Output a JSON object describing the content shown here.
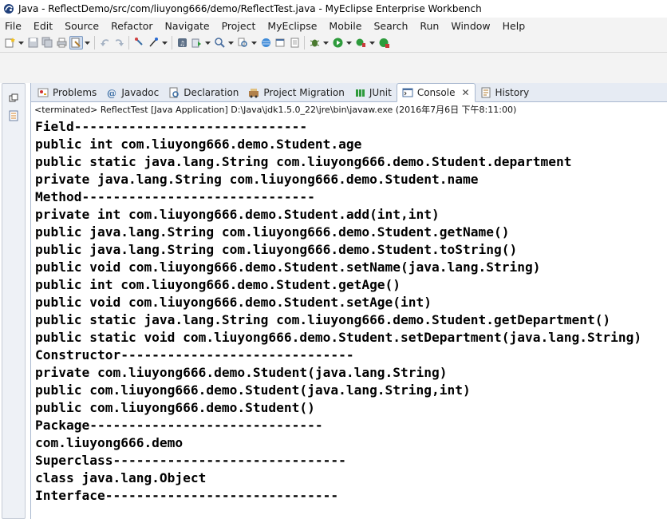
{
  "window": {
    "title": "Java - ReflectDemo/src/com/liuyong666/demo/ReflectTest.java - MyEclipse Enterprise Workbench",
    "icon": "myeclipse-icon"
  },
  "menubar": {
    "items": [
      "File",
      "Edit",
      "Source",
      "Refactor",
      "Navigate",
      "Project",
      "MyEclipse",
      "Mobile",
      "Search",
      "Run",
      "Window",
      "Help"
    ]
  },
  "toolbar": {
    "icons": [
      "new-icon",
      "save-icon",
      "save-all-icon",
      "print-icon",
      "open-type-icon",
      "toggle-mark-icon",
      "back-icon",
      "forward-icon",
      "pin-icon",
      "search-icon",
      "server-icon",
      "deploy-icon",
      "web-browser-icon",
      "open-perspective-icon",
      "debug-icon",
      "run-icon",
      "external-tools-icon"
    ]
  },
  "view": {
    "tabs": [
      {
        "label": "Problems",
        "icon": "problems-icon",
        "active": false
      },
      {
        "label": "Javadoc",
        "icon": "javadoc-icon",
        "active": false
      },
      {
        "label": "Declaration",
        "icon": "declaration-icon",
        "active": false
      },
      {
        "label": "Project Migration",
        "icon": "migration-icon",
        "active": false
      },
      {
        "label": "JUnit",
        "icon": "junit-icon",
        "active": false
      },
      {
        "label": "Console",
        "icon": "console-icon",
        "active": true
      },
      {
        "label": "History",
        "icon": "history-icon",
        "active": false
      }
    ],
    "close_glyph": "✕",
    "status": "<terminated> ReflectTest [Java Application] D:\\Java\\jdk1.5.0_22\\jre\\bin\\javaw.exe (2016年7月6日 下午8:11:00)"
  },
  "console": {
    "lines": [
      "Field------------------------------",
      "public int com.liuyong666.demo.Student.age",
      "public static java.lang.String com.liuyong666.demo.Student.department",
      "private java.lang.String com.liuyong666.demo.Student.name",
      "Method------------------------------",
      "private int com.liuyong666.demo.Student.add(int,int)",
      "public java.lang.String com.liuyong666.demo.Student.getName()",
      "public java.lang.String com.liuyong666.demo.Student.toString()",
      "public void com.liuyong666.demo.Student.setName(java.lang.String)",
      "public int com.liuyong666.demo.Student.getAge()",
      "public void com.liuyong666.demo.Student.setAge(int)",
      "public static java.lang.String com.liuyong666.demo.Student.getDepartment()",
      "public static void com.liuyong666.demo.Student.setDepartment(java.lang.String)",
      "Constructor------------------------------",
      "private com.liuyong666.demo.Student(java.lang.String)",
      "public com.liuyong666.demo.Student(java.lang.String,int)",
      "public com.liuyong666.demo.Student()",
      "Package------------------------------",
      "com.liuyong666.demo",
      "Superclass------------------------------",
      "class java.lang.Object",
      "Interface------------------------------"
    ]
  },
  "trim": {
    "icons": [
      "restore-icon",
      "outline-icon"
    ]
  },
  "colors": {
    "accent": "#3a6ea5",
    "tab_bar": "#e6ebf3",
    "chrome": "#f3f3f3"
  }
}
